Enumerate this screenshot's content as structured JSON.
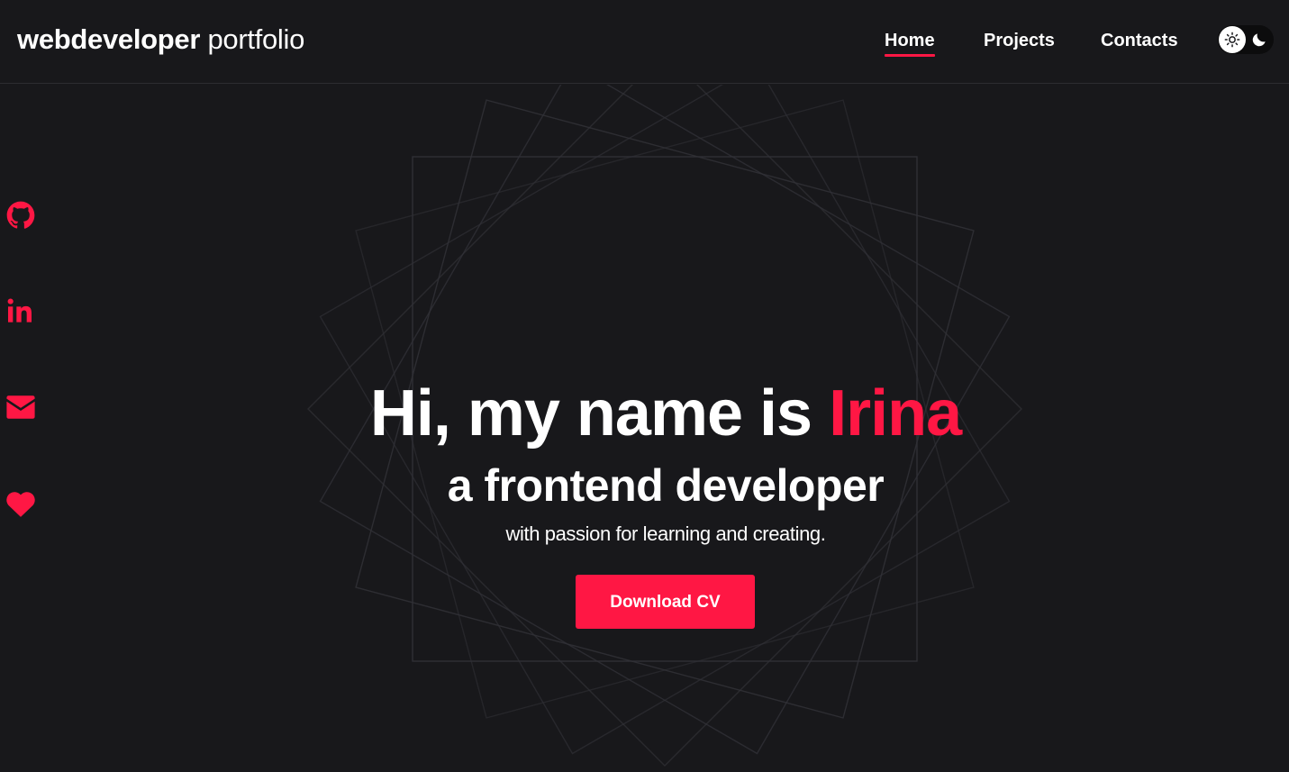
{
  "header": {
    "logo_bold": "webdeveloper",
    "logo_light": " portfolio",
    "nav": [
      {
        "label": "Home",
        "active": true
      },
      {
        "label": "Projects",
        "active": false
      },
      {
        "label": "Contacts",
        "active": false
      }
    ],
    "theme_toggle": {
      "state": "dark",
      "icons": [
        "sun-icon",
        "moon-icon"
      ]
    }
  },
  "socials": [
    {
      "icon": "github-icon"
    },
    {
      "icon": "linkedin-icon"
    },
    {
      "icon": "mail-icon"
    },
    {
      "icon": "heart-icon"
    }
  ],
  "hero": {
    "greeting": "Hi, my name is ",
    "name": "Irina",
    "role": "a frontend developer",
    "tagline": "with passion for learning and creating.",
    "cta_label": "Download CV"
  },
  "colors": {
    "background": "#18181b",
    "accent": "#ff1744",
    "text": "#ffffff",
    "decor_lines": "#3a3a3e"
  }
}
